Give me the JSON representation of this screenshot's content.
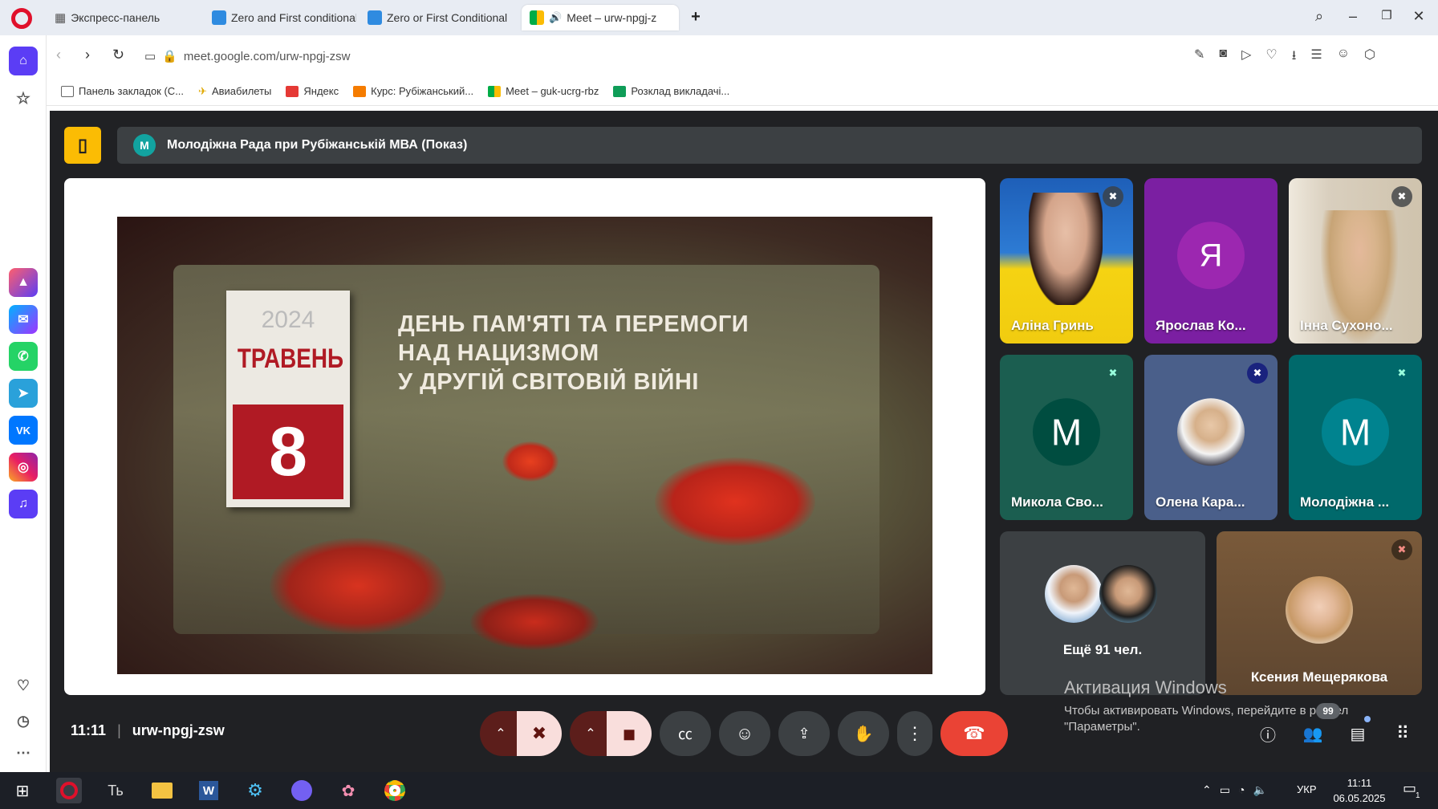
{
  "browser": {
    "tabs": [
      {
        "label": "Экспресс-панель",
        "icon": "grid-icon"
      },
      {
        "label": "Zero and First conditional",
        "icon": "puzzle-favicon"
      },
      {
        "label": "Zero or First Conditional",
        "icon": "puzzle-favicon"
      },
      {
        "label": "Meet – urw-npgj-z",
        "icon": "meet-favicon",
        "active": true
      }
    ],
    "url": "meet.google.com/urw-npgj-zsw",
    "bookmarks": [
      {
        "label": "Панель закладок (С...",
        "icon": "folder-icon",
        "color": "#666666"
      },
      {
        "label": "Авиабилеты",
        "icon": "plane-icon",
        "color": "#e0a800"
      },
      {
        "label": "Яндекс",
        "icon": "yandex-icon",
        "color": "#e53935"
      },
      {
        "label": "Курс: Рубіжанський...",
        "icon": "course-icon",
        "color": "#f57c00"
      },
      {
        "label": "Meet – guk-ucrg-rbz",
        "icon": "meet-favicon",
        "color": "#00897b"
      },
      {
        "label": "Розклад викладачі...",
        "icon": "sheets-icon",
        "color": "#0f9d58"
      }
    ]
  },
  "meet": {
    "meeting_title": "Молодіжна Рада при Рубіжанській МВА (Показ)",
    "presenter_initial": "М",
    "slide": {
      "calendar_year": "2024",
      "calendar_month": "ТРАВЕНЬ",
      "calendar_day": "8",
      "headline_lines": [
        "ДЕНЬ ПАМ'ЯТІ ТА ПЕРЕМОГИ",
        "НАД НАЦИЗМОМ",
        "У ДРУГІЙ СВІТОВІЙ ВІЙНІ"
      ]
    },
    "participants": [
      {
        "name": "Аліна Гринь",
        "type": "video",
        "muted": true
      },
      {
        "name": "Ярослав Ко...",
        "type": "avatar",
        "initial": "Я",
        "bg": "#7b1fa2",
        "avatar_bg": "#9c27b0",
        "muted": false
      },
      {
        "name": "Інна Сухоно...",
        "type": "video",
        "muted": true
      },
      {
        "name": "Микола Сво...",
        "type": "avatar",
        "initial": "М",
        "bg": "#1b5e50",
        "avatar_bg": "#004d40",
        "muted": true
      },
      {
        "name": "Олена Кара...",
        "type": "photo",
        "bg": "#4a5f8a",
        "muted": true
      },
      {
        "name": "Молодіжна ...",
        "type": "avatar",
        "initial": "М",
        "bg": "#00696b",
        "avatar_bg": "#00838f",
        "muted": true
      }
    ],
    "more_participants": "Ещё 91 чел.",
    "featured": {
      "name": "Ксения Мещерякова",
      "muted": true
    },
    "clock": "11:11",
    "meeting_code": "urw-npgj-zsw",
    "people_badge": "99",
    "windows_activation": {
      "title": "Активация Windows",
      "line1": "Чтобы активировать Windows, перейдите в раздел",
      "line2": "\"Параметры\"."
    },
    "colors": {
      "end_call": "#ea4335",
      "muted_bg": "#f9dedc",
      "bg": "#202124"
    }
  },
  "taskbar": {
    "language": "УКР",
    "time": "11:11",
    "date": "06.05.2025",
    "notif_count": "1"
  }
}
